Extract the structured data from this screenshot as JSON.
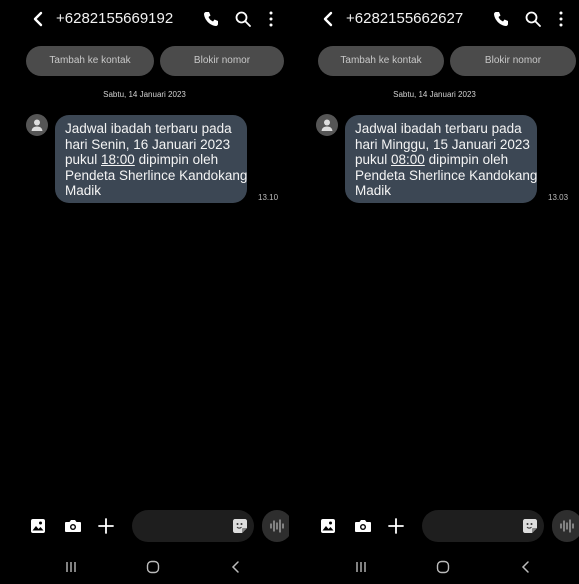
{
  "screens": [
    {
      "header": {
        "phone_number": "+6282155669192"
      },
      "actions": {
        "add_contact": "Tambah ke kontak",
        "block_number": "Blokir nomor"
      },
      "date_separator": "Sabtu, 14 Januari 2023",
      "message": {
        "line1": "Jadwal ibadah terbaru pada",
        "line2": "hari Senin, 16 Januari 2023",
        "line3_pre": "pukul ",
        "line3_time": "18:00",
        "line3_post": " dipimpin oleh",
        "line4": "Pendeta Sherlince Kandokang",
        "line5": "Madik",
        "time": "13.10"
      }
    },
    {
      "header": {
        "phone_number": "+6282155662627"
      },
      "actions": {
        "add_contact": "Tambah ke kontak",
        "block_number": "Blokir nomor"
      },
      "date_separator": "Sabtu, 14 Januari 2023",
      "message": {
        "line1": "Jadwal ibadah terbaru pada",
        "line2": "hari Minggu, 15 Januari 2023",
        "line3_pre": "pukul ",
        "line3_time": "08:00",
        "line3_post": " dipimpin oleh",
        "line4": "Pendeta Sherlince Kandokang",
        "line5": "Madik",
        "time": "13.03"
      }
    }
  ],
  "icons": {
    "back": "chevron-left-icon",
    "call": "phone-icon",
    "search": "search-icon",
    "more": "more-vertical-icon",
    "avatar": "person-icon",
    "gallery": "image-icon",
    "camera": "camera-icon",
    "plus": "plus-icon",
    "sticker": "sticker-icon",
    "voice": "voice-wave-icon",
    "nav_recents": "recents-icon",
    "nav_home": "home-icon",
    "nav_back": "back-chevron-icon"
  },
  "colors": {
    "background": "#000000",
    "bubble": "#3c4754",
    "pill": "#4b4b4b",
    "input": "#1e1e1e"
  }
}
